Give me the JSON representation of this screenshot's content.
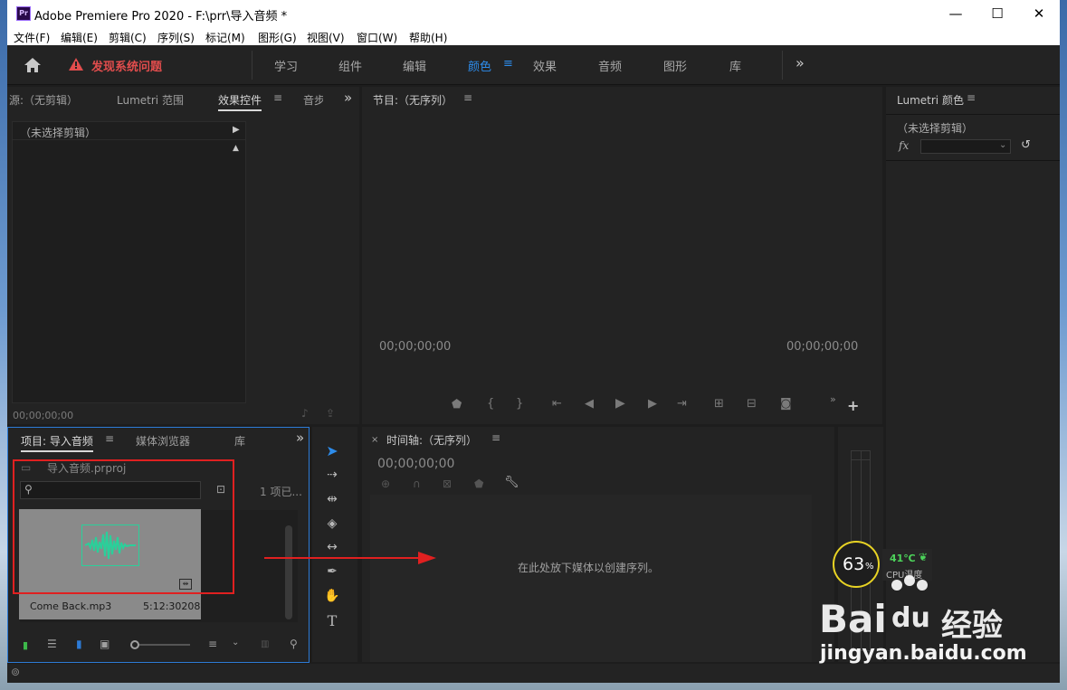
{
  "window": {
    "app_logo": "Pr",
    "title": "Adobe Premiere Pro 2020 - F:\\prr\\导入音频 *",
    "minimize_glyph": "—",
    "maximize_glyph": "☐",
    "close_glyph": "✕"
  },
  "menu": [
    "文件(F)",
    "编辑(E)",
    "剪辑(C)",
    "序列(S)",
    "标记(M)",
    "图形(G)",
    "视图(V)",
    "窗口(W)",
    "帮助(H)"
  ],
  "workspace": {
    "warning": "发现系统问题",
    "tabs": [
      "学习",
      "组件",
      "编辑",
      "颜色",
      "效果",
      "音频",
      "图形",
      "库"
    ],
    "active_tab": "颜色",
    "accent": "#2d8ceb",
    "more_glyph": "»"
  },
  "source_panel": {
    "tabs": [
      "源:（无剪辑）",
      "Lumetri 范围",
      "效果控件",
      "音步"
    ],
    "active_tab": "效果控件",
    "clip_header": "（未选择剪辑）",
    "timecode": "00;00;00;00"
  },
  "program_monitor": {
    "title": "节目:（无序列）",
    "timecode_left": "00;00;00;00",
    "timecode_right": "00;00;00;00"
  },
  "lumetri": {
    "title": "Lumetri 颜色",
    "clip_header": "（未选择剪辑）",
    "fx_label": "fx"
  },
  "project_panel": {
    "tabs": [
      "项目: 导入音频",
      "媒体浏览器",
      "库"
    ],
    "active_tab": "项目: 导入音频",
    "file": "导入音频.prproj",
    "item_count": "1 项已...",
    "clip_name": "Come Back.mp3",
    "clip_duration": "5:12:30208"
  },
  "timeline": {
    "title": "时间轴:（无序列）",
    "timecode": "00;00;00;00",
    "drop_hint": "在此处放下媒体以创建序列。"
  },
  "overlay": {
    "cpu_percent": "63",
    "percent_sign": "%",
    "cpu_temp": "41℃",
    "cpu_label": "CPU温度",
    "watermark_brand": "Bai",
    "watermark_paw": "du",
    "watermark_cn": "经验",
    "watermark_url": "jingyan.baidu.com"
  }
}
